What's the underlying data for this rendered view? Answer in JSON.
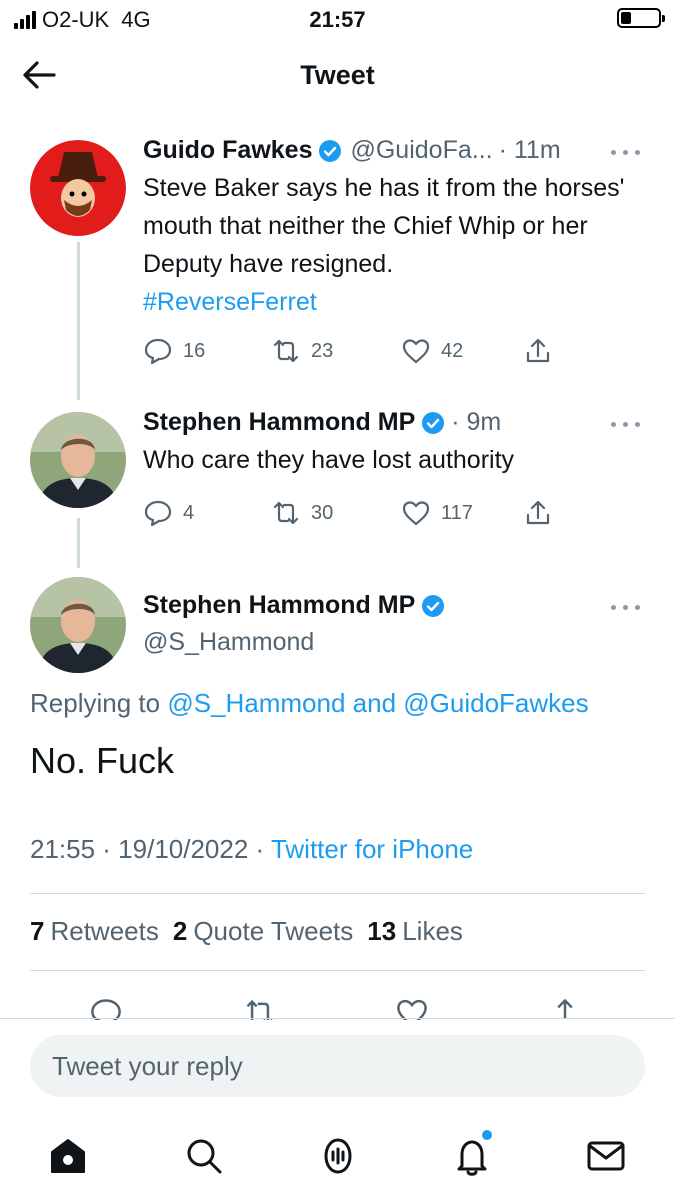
{
  "status_bar": {
    "carrier": "O2-UK",
    "network": "4G",
    "time": "21:57"
  },
  "header": {
    "title": "Tweet"
  },
  "thread": [
    {
      "name": "Guido Fawkes",
      "handle": "@GuidoFa...",
      "time": "· 11m",
      "text": "Steve Baker says he has it from the horses' mouth that neither the Chief Whip or her Deputy have resigned.",
      "hashtag": "#ReverseFerret",
      "replies": "16",
      "retweets": "23",
      "likes": "42"
    },
    {
      "name": "Stephen Hammond MP",
      "handle": "",
      "time": "· 9m",
      "text": "Who care they have lost authority",
      "replies": "4",
      "retweets": "30",
      "likes": "117"
    }
  ],
  "main_tweet": {
    "name": "Stephen Hammond MP",
    "handle": "@S_Hammond",
    "replying_prefix": "Replying to",
    "replying_mentions": "@S_Hammond and @GuidoFawkes",
    "text": "No. Fuck",
    "timestamp": "21:55 · 19/10/2022 ·",
    "source": "Twitter for iPhone",
    "retweets_count": "7",
    "retweets_label": "Retweets",
    "quotes_count": "2",
    "quotes_label": "Quote Tweets",
    "likes_count": "13",
    "likes_label": "Likes"
  },
  "reply": {
    "placeholder": "Tweet your reply"
  },
  "icons": {
    "back": "arrow-left-icon",
    "verified": "verified-badge-icon",
    "reply": "reply-icon",
    "retweet": "retweet-icon",
    "like": "heart-icon",
    "share": "share-icon",
    "home": "home-icon",
    "search": "search-icon",
    "spaces": "spaces-icon",
    "notifications": "bell-icon",
    "messages": "mail-icon"
  },
  "colors": {
    "accent": "#1d9bf0",
    "text": "#0f1419",
    "muted": "#536471",
    "divider": "#cfd9de"
  }
}
